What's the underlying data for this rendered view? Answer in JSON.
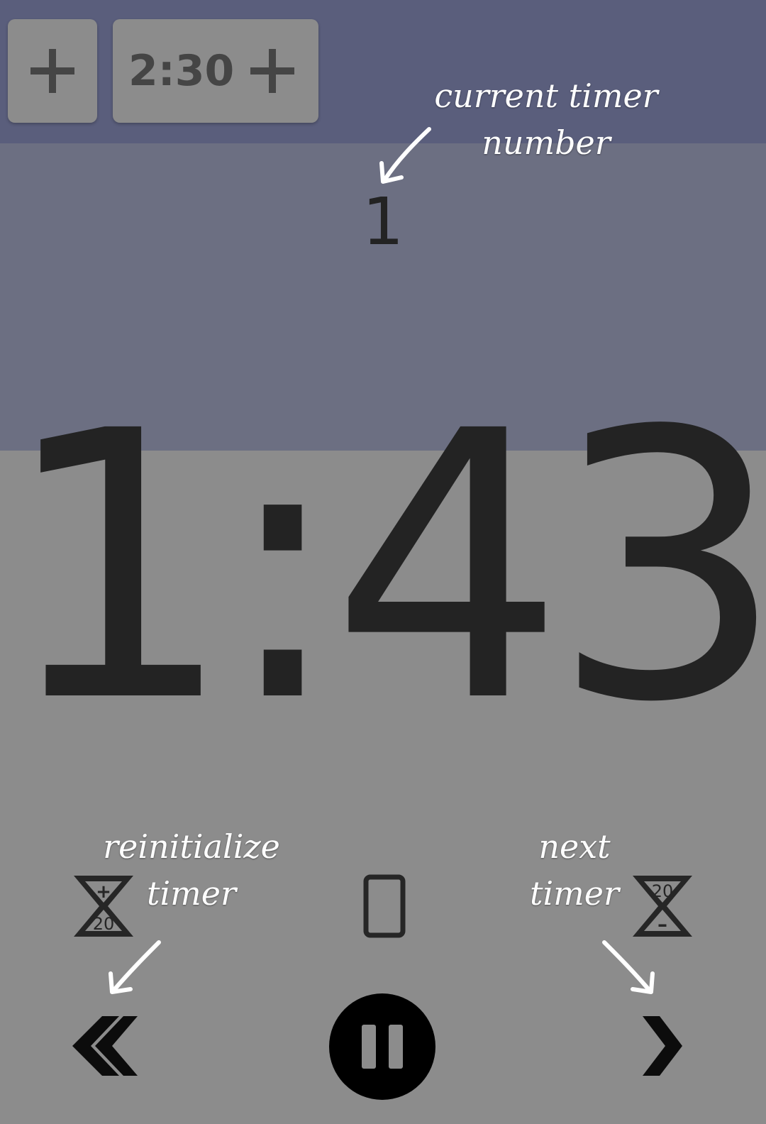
{
  "toolbar": {
    "add_button_icon": "plus-icon",
    "preset": {
      "label": "2:30",
      "add_icon": "plus-icon"
    }
  },
  "timer": {
    "current_number": "1",
    "display": "1:43"
  },
  "annotations": {
    "current_timer_number": "current timer number",
    "reinitialize_timer": "reinitialize timer",
    "next_timer": "next timer"
  },
  "hourglass_reset": {
    "plus": "+",
    "value": "20"
  },
  "hourglass_next": {
    "value": "20",
    "minus": "–"
  },
  "controls": {
    "reset_icon": "double-chevron-left-icon",
    "pause_icon": "pause-icon",
    "next_icon": "chevron-right-icon",
    "screen_icon": "phone-outline-icon"
  },
  "colors": {
    "topbar": "#5a5e7c",
    "progress": "#6c6f82",
    "background": "#8c8c8c",
    "digits": "#232323"
  }
}
